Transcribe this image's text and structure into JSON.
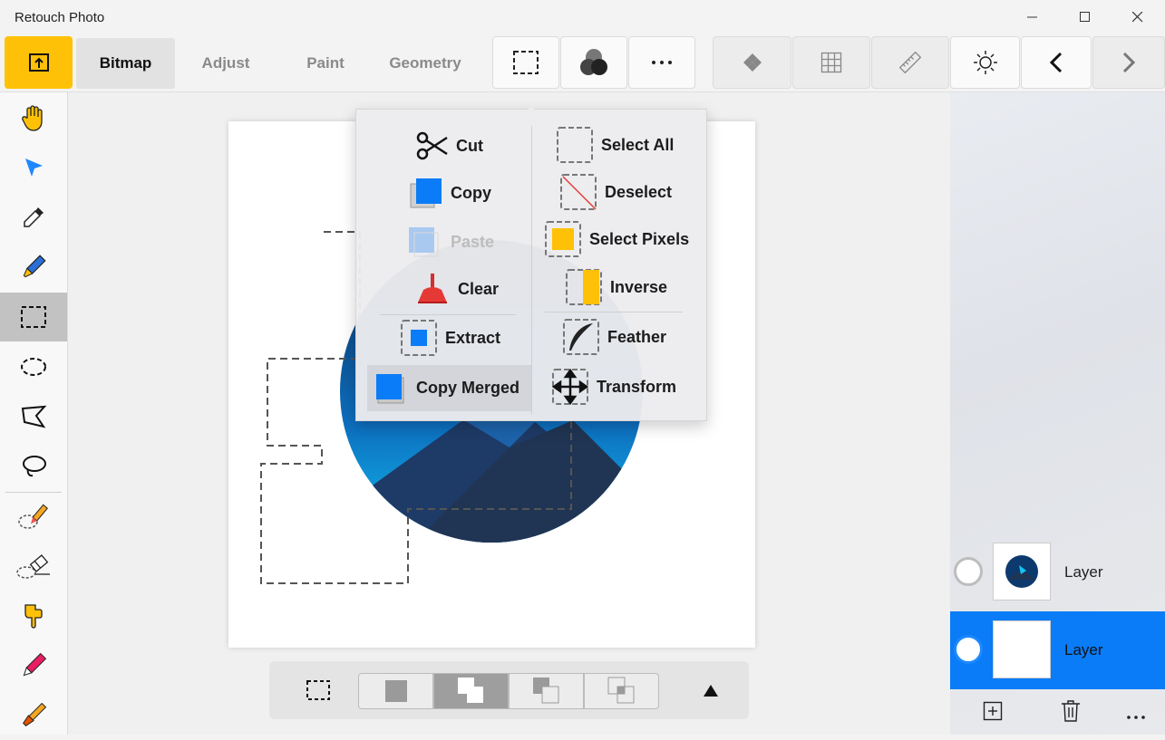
{
  "window": {
    "title": "Retouch Photo"
  },
  "tabs": [
    {
      "label": "Bitmap"
    },
    {
      "label": "Adjust"
    },
    {
      "label": "Paint"
    },
    {
      "label": "Geometry"
    }
  ],
  "menu": {
    "left": [
      {
        "label": "Cut",
        "icon": "scissors-icon"
      },
      {
        "label": "Copy",
        "icon": "copy-icon"
      },
      {
        "label": "Paste",
        "icon": "paste-icon",
        "disabled": true
      },
      {
        "label": "Clear",
        "icon": "broom-icon"
      },
      {
        "label": "Extract",
        "icon": "extract-icon"
      },
      {
        "label": "Copy Merged",
        "icon": "copy-merged-icon"
      }
    ],
    "right": [
      {
        "label": "Select All",
        "icon": "select-all-icon"
      },
      {
        "label": "Deselect",
        "icon": "deselect-icon"
      },
      {
        "label": "Select Pixels",
        "icon": "select-pixels-icon"
      },
      {
        "label": "Inverse",
        "icon": "inverse-icon"
      },
      {
        "label": "Feather",
        "icon": "feather-icon"
      },
      {
        "label": "Transform",
        "icon": "transform-icon"
      }
    ]
  },
  "layers": [
    {
      "label": "Layer",
      "active": false
    },
    {
      "label": "Layer",
      "active": true
    }
  ],
  "colors": {
    "accent": "#ffc107",
    "selection": "#0a7cf7",
    "blue": "#0a7cf7"
  }
}
